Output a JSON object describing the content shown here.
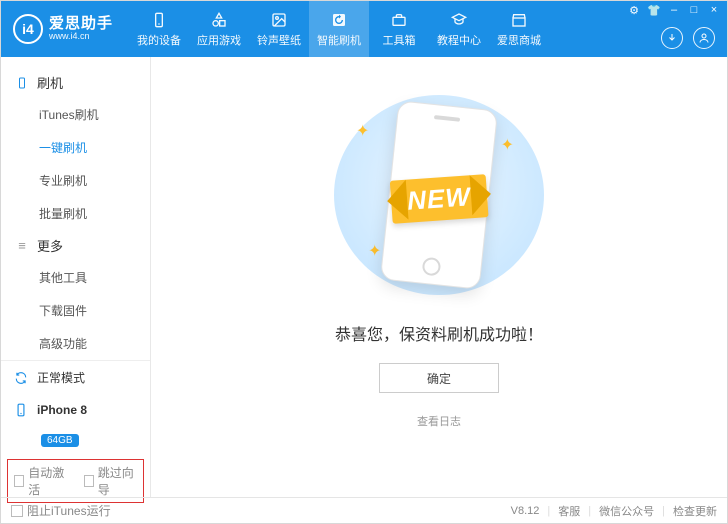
{
  "app": {
    "name": "爱思助手",
    "url": "www.i4.cn",
    "logo_text": "i4"
  },
  "topbar": {
    "tabs": [
      {
        "label": "我的设备"
      },
      {
        "label": "应用游戏"
      },
      {
        "label": "铃声壁纸"
      },
      {
        "label": "智能刷机"
      },
      {
        "label": "工具箱"
      },
      {
        "label": "教程中心"
      },
      {
        "label": "爱思商城"
      }
    ],
    "active_index": 3,
    "window_controls": {
      "settings": "⚙",
      "skin": "👕",
      "min": "–",
      "max": "□",
      "close": "×"
    }
  },
  "sidebar": {
    "groups": [
      {
        "title": "刷机",
        "items": [
          {
            "label": "iTunes刷机"
          },
          {
            "label": "一键刷机"
          },
          {
            "label": "专业刷机"
          },
          {
            "label": "批量刷机"
          }
        ],
        "active_index": 1
      },
      {
        "title": "更多",
        "items": [
          {
            "label": "其他工具"
          },
          {
            "label": "下载固件"
          },
          {
            "label": "高级功能"
          }
        ],
        "active_index": -1
      }
    ],
    "mode": "正常模式",
    "device": {
      "name": "iPhone 8",
      "storage": "64GB"
    },
    "highlight_checks": [
      {
        "label": "自动激活"
      },
      {
        "label": "跳过向导"
      }
    ]
  },
  "main": {
    "ribbon": "NEW",
    "message": "恭喜您，保资料刷机成功啦！",
    "ok": "确定",
    "log": "查看日志"
  },
  "status": {
    "block_itunes": "阻止iTunes运行",
    "version": "V8.12",
    "support": "客服",
    "wechat": "微信公众号",
    "update": "检查更新"
  }
}
